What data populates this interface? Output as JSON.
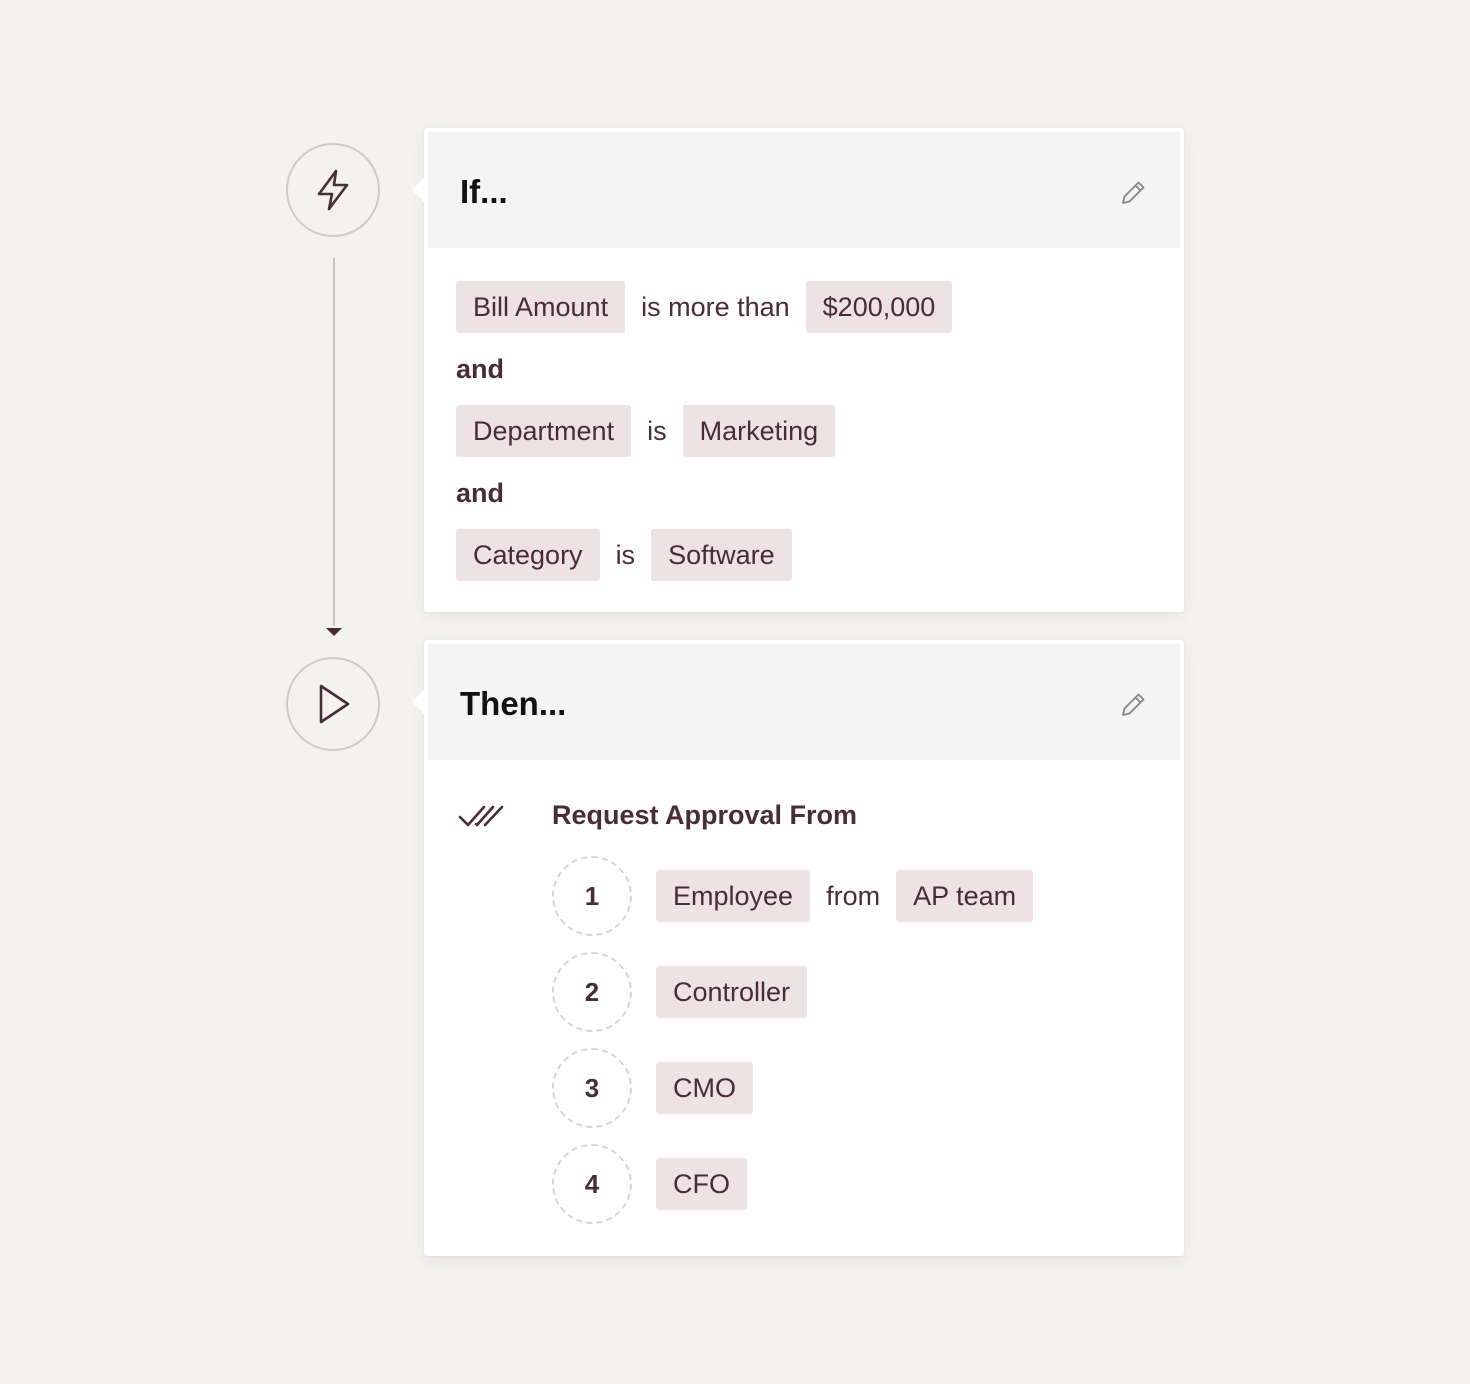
{
  "colors": {
    "background": "#f3f2ee",
    "card": "#ffffff",
    "card_header": "#f4f4f4",
    "pill": "#ede2e4",
    "text": "#4a2c38",
    "title": "#111111"
  },
  "trigger": {
    "icon": "lightning-bolt-icon"
  },
  "action": {
    "icon": "play-icon"
  },
  "condition_card": {
    "title": "If...",
    "edit_icon": "pencil-icon",
    "rows": [
      {
        "field": "Bill Amount",
        "operator": "is more than",
        "value": "$200,000"
      },
      {
        "field": "Department",
        "operator": "is",
        "value": "Marketing"
      },
      {
        "field": "Category",
        "operator": "is",
        "value": "Software"
      }
    ],
    "joiners": [
      "and",
      "and"
    ]
  },
  "action_card": {
    "title": "Then...",
    "edit_icon": "pencil-icon",
    "action_icon": "double-check-icon",
    "action_label": "Request Approval From",
    "approvers": [
      {
        "order": "1",
        "role": "Employee",
        "connector": "from",
        "group": "AP team"
      },
      {
        "order": "2",
        "role": "Controller"
      },
      {
        "order": "3",
        "role": "CMO"
      },
      {
        "order": "4",
        "role": "CFO"
      }
    ]
  }
}
